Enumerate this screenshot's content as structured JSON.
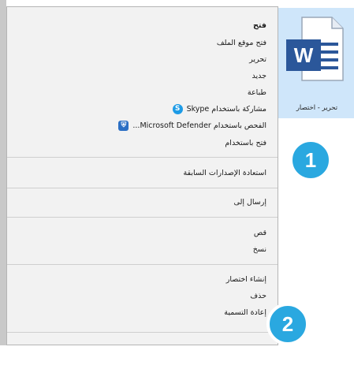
{
  "context_menu": {
    "items": [
      {
        "label": "فتح",
        "bold": true
      },
      {
        "label": "فتح موقع الملف"
      },
      {
        "label": "تحرير"
      },
      {
        "label": "جديد"
      },
      {
        "label": "طباعة"
      },
      {
        "label": "مشاركة باستخدام Skype",
        "icon": "skype-icon"
      },
      {
        "label": "الفحص باستخدام Microsoft Defender...",
        "icon": "defender-icon"
      },
      {
        "label": "فتح باستخدام"
      },
      {
        "label": "استعادة الإصدارات السابقة"
      },
      {
        "label": "إرسال إلى"
      },
      {
        "label": "قص"
      },
      {
        "label": "نسخ"
      },
      {
        "label": "إنشاء اختصار"
      },
      {
        "label": "حذف"
      },
      {
        "label": "إعادة التسمية"
      }
    ]
  },
  "file": {
    "name": "تحرير - اختصار",
    "icon": "word-document-icon",
    "icon_letter": "W"
  },
  "callouts": [
    {
      "number": "1"
    },
    {
      "number": "2"
    }
  ],
  "colors": {
    "callout": "#2aa8e0",
    "word_blue": "#2b579a",
    "selection": "#cfe6fa"
  }
}
